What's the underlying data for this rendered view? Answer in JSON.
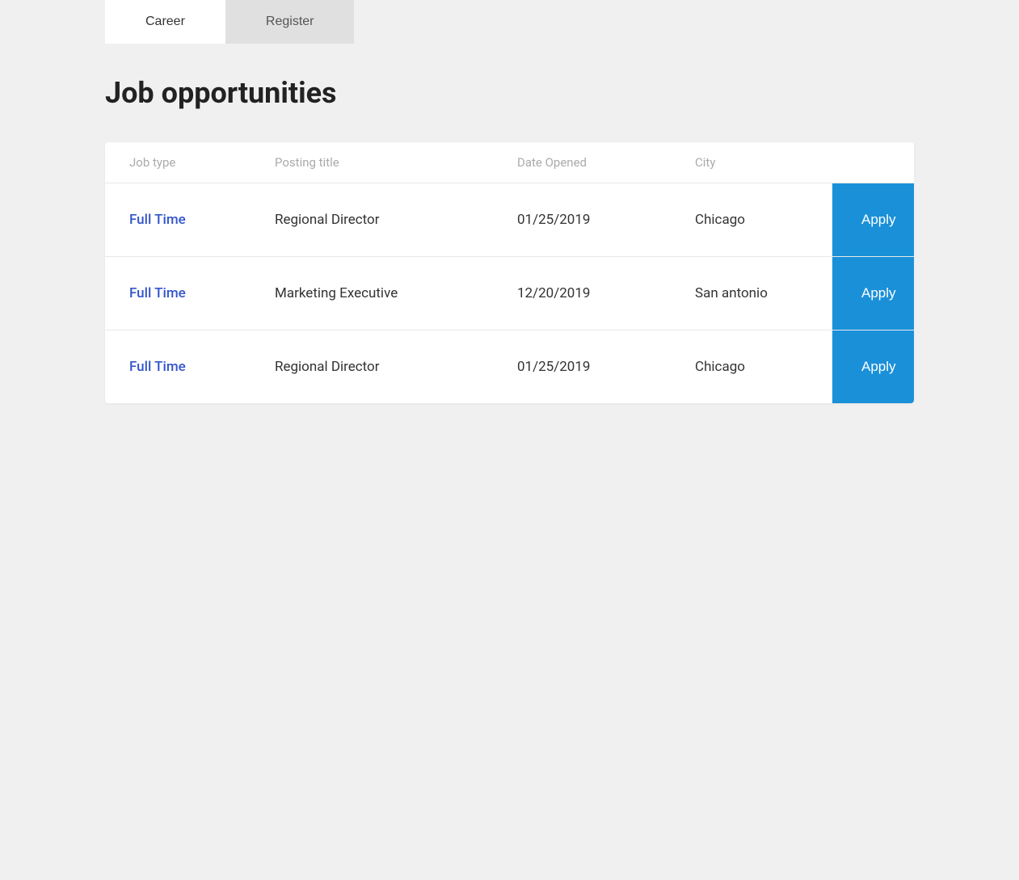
{
  "tabs": [
    {
      "id": "career",
      "label": "Career",
      "active": true
    },
    {
      "id": "register",
      "label": "Register",
      "active": false
    }
  ],
  "page": {
    "title": "Job opportunities"
  },
  "table": {
    "columns": [
      {
        "id": "job_type",
        "label": "Job type"
      },
      {
        "id": "posting_title",
        "label": "Posting title"
      },
      {
        "id": "date_opened",
        "label": "Date Opened"
      },
      {
        "id": "city",
        "label": "City"
      }
    ],
    "rows": [
      {
        "job_type": "Full Time",
        "posting_title": "Regional Director",
        "date_opened": "01/25/2019",
        "city": "Chicago",
        "apply_label": "Apply"
      },
      {
        "job_type": "Full Time",
        "posting_title": "Marketing Executive",
        "date_opened": "12/20/2019",
        "city": "San antonio",
        "apply_label": "Apply"
      },
      {
        "job_type": "Full Time",
        "posting_title": "Regional Director",
        "date_opened": "01/25/2019",
        "city": "Chicago",
        "apply_label": "Apply"
      }
    ]
  }
}
